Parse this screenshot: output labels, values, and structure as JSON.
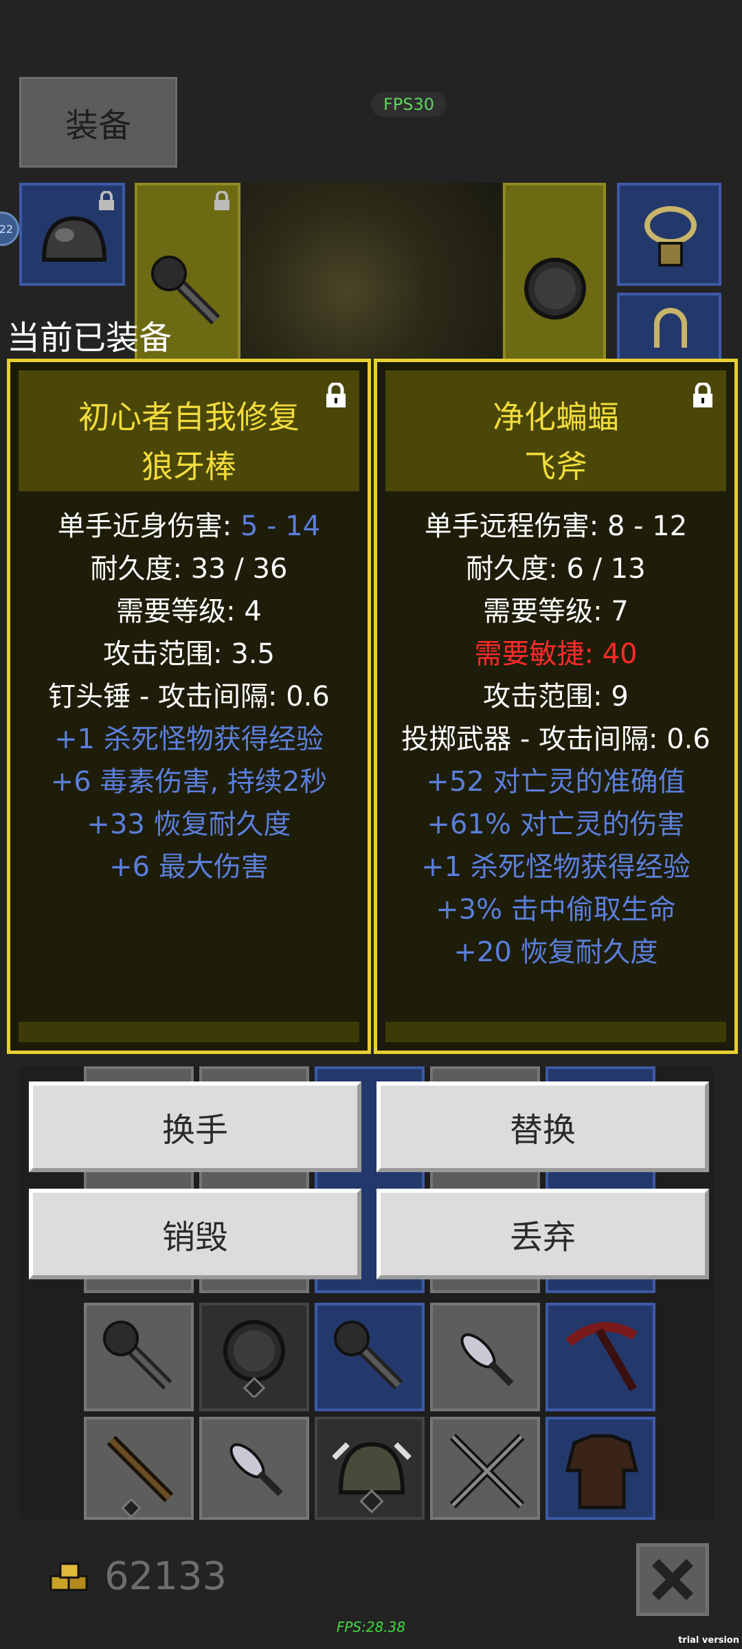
{
  "top": {
    "tab_label": "装备",
    "fps_badge": "FPS30"
  },
  "equipment_strip": {
    "slots": [
      {
        "name": "helmet",
        "icon": "helmet-icon",
        "locked": true
      },
      {
        "name": "main-hand",
        "icon": "club-icon",
        "locked": true
      },
      {
        "name": "off-hand",
        "icon": "shield-icon",
        "locked": false
      },
      {
        "name": "amulet",
        "icon": "amulet-icon",
        "locked": false
      },
      {
        "name": "ring",
        "icon": "ring-icon",
        "locked": false
      }
    ],
    "badge_text": "22"
  },
  "current_label": "当前已装备",
  "left_item": {
    "prefix": "初心者自我修复",
    "name": "狼牙棒",
    "locked": true,
    "stats": {
      "damage_label": "单手近身伤害: ",
      "damage_value": "5 - 14",
      "durability": "耐久度: 33 / 36",
      "level": "需要等级: 4",
      "range": "攻击范围: 3.5",
      "speed": "钉头锤 - 攻击间隔: 0.6"
    },
    "mods": [
      "+1 杀死怪物获得经验",
      "+6 毒素伤害, 持续2秒",
      "+33 恢复耐久度",
      "+6 最大伤害"
    ]
  },
  "right_item": {
    "prefix": "净化蝙蝠",
    "name": "飞斧",
    "locked": true,
    "stats": {
      "damage": "单手远程伤害: 8 - 12",
      "durability": "耐久度: 6 / 13",
      "level": "需要等级: 7",
      "dex_req": "需要敏捷: 40",
      "range": "攻击范围: 9",
      "speed": "投掷武器 - 攻击间隔: 0.6"
    },
    "mods": [
      "+52 对亡灵的准确值",
      "+61% 对亡灵的伤害",
      "+1 杀死怪物获得经验",
      "+3% 击中偷取生命",
      "+20 恢复耐久度"
    ]
  },
  "actions": {
    "swap_hand": "换手",
    "replace": "替换",
    "destroy": "销毁",
    "drop": "丢弃"
  },
  "inventory": {
    "row1": [
      "club-icon",
      "shield-icon",
      "club-icon",
      "dagger-icon",
      "pickaxe-icon"
    ],
    "row2": [
      "staff-icon",
      "dagger-icon",
      "helmet-icon",
      "crossed-swords-icon",
      "armor-icon"
    ]
  },
  "footer": {
    "gold": "62133",
    "fps": "FPS:28.38",
    "trial": "trial version"
  }
}
